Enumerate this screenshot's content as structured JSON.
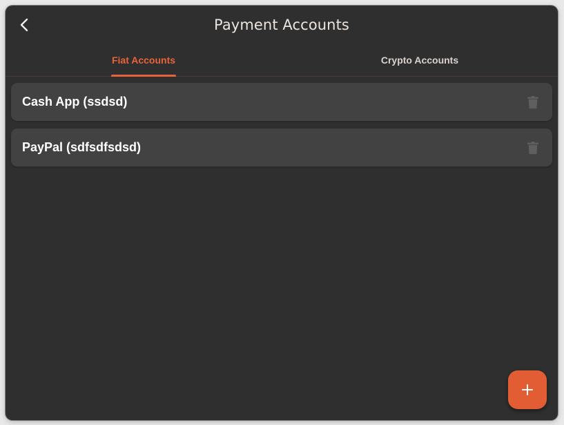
{
  "header": {
    "title": "Payment Accounts",
    "back_icon": "chevron-left-icon"
  },
  "tabs": [
    {
      "label": "Fiat Accounts",
      "active": true
    },
    {
      "label": "Crypto Accounts",
      "active": false
    }
  ],
  "accounts": [
    {
      "name": "Cash App (ssdsd)",
      "action_icon": "trash-icon"
    },
    {
      "name": "PayPal (sdfsdfsdsd)",
      "action_icon": "trash-icon"
    }
  ],
  "fab": {
    "icon": "plus-icon"
  },
  "colors": {
    "accent": "#e8633a",
    "background": "#2f2f2f",
    "card": "#424242"
  }
}
